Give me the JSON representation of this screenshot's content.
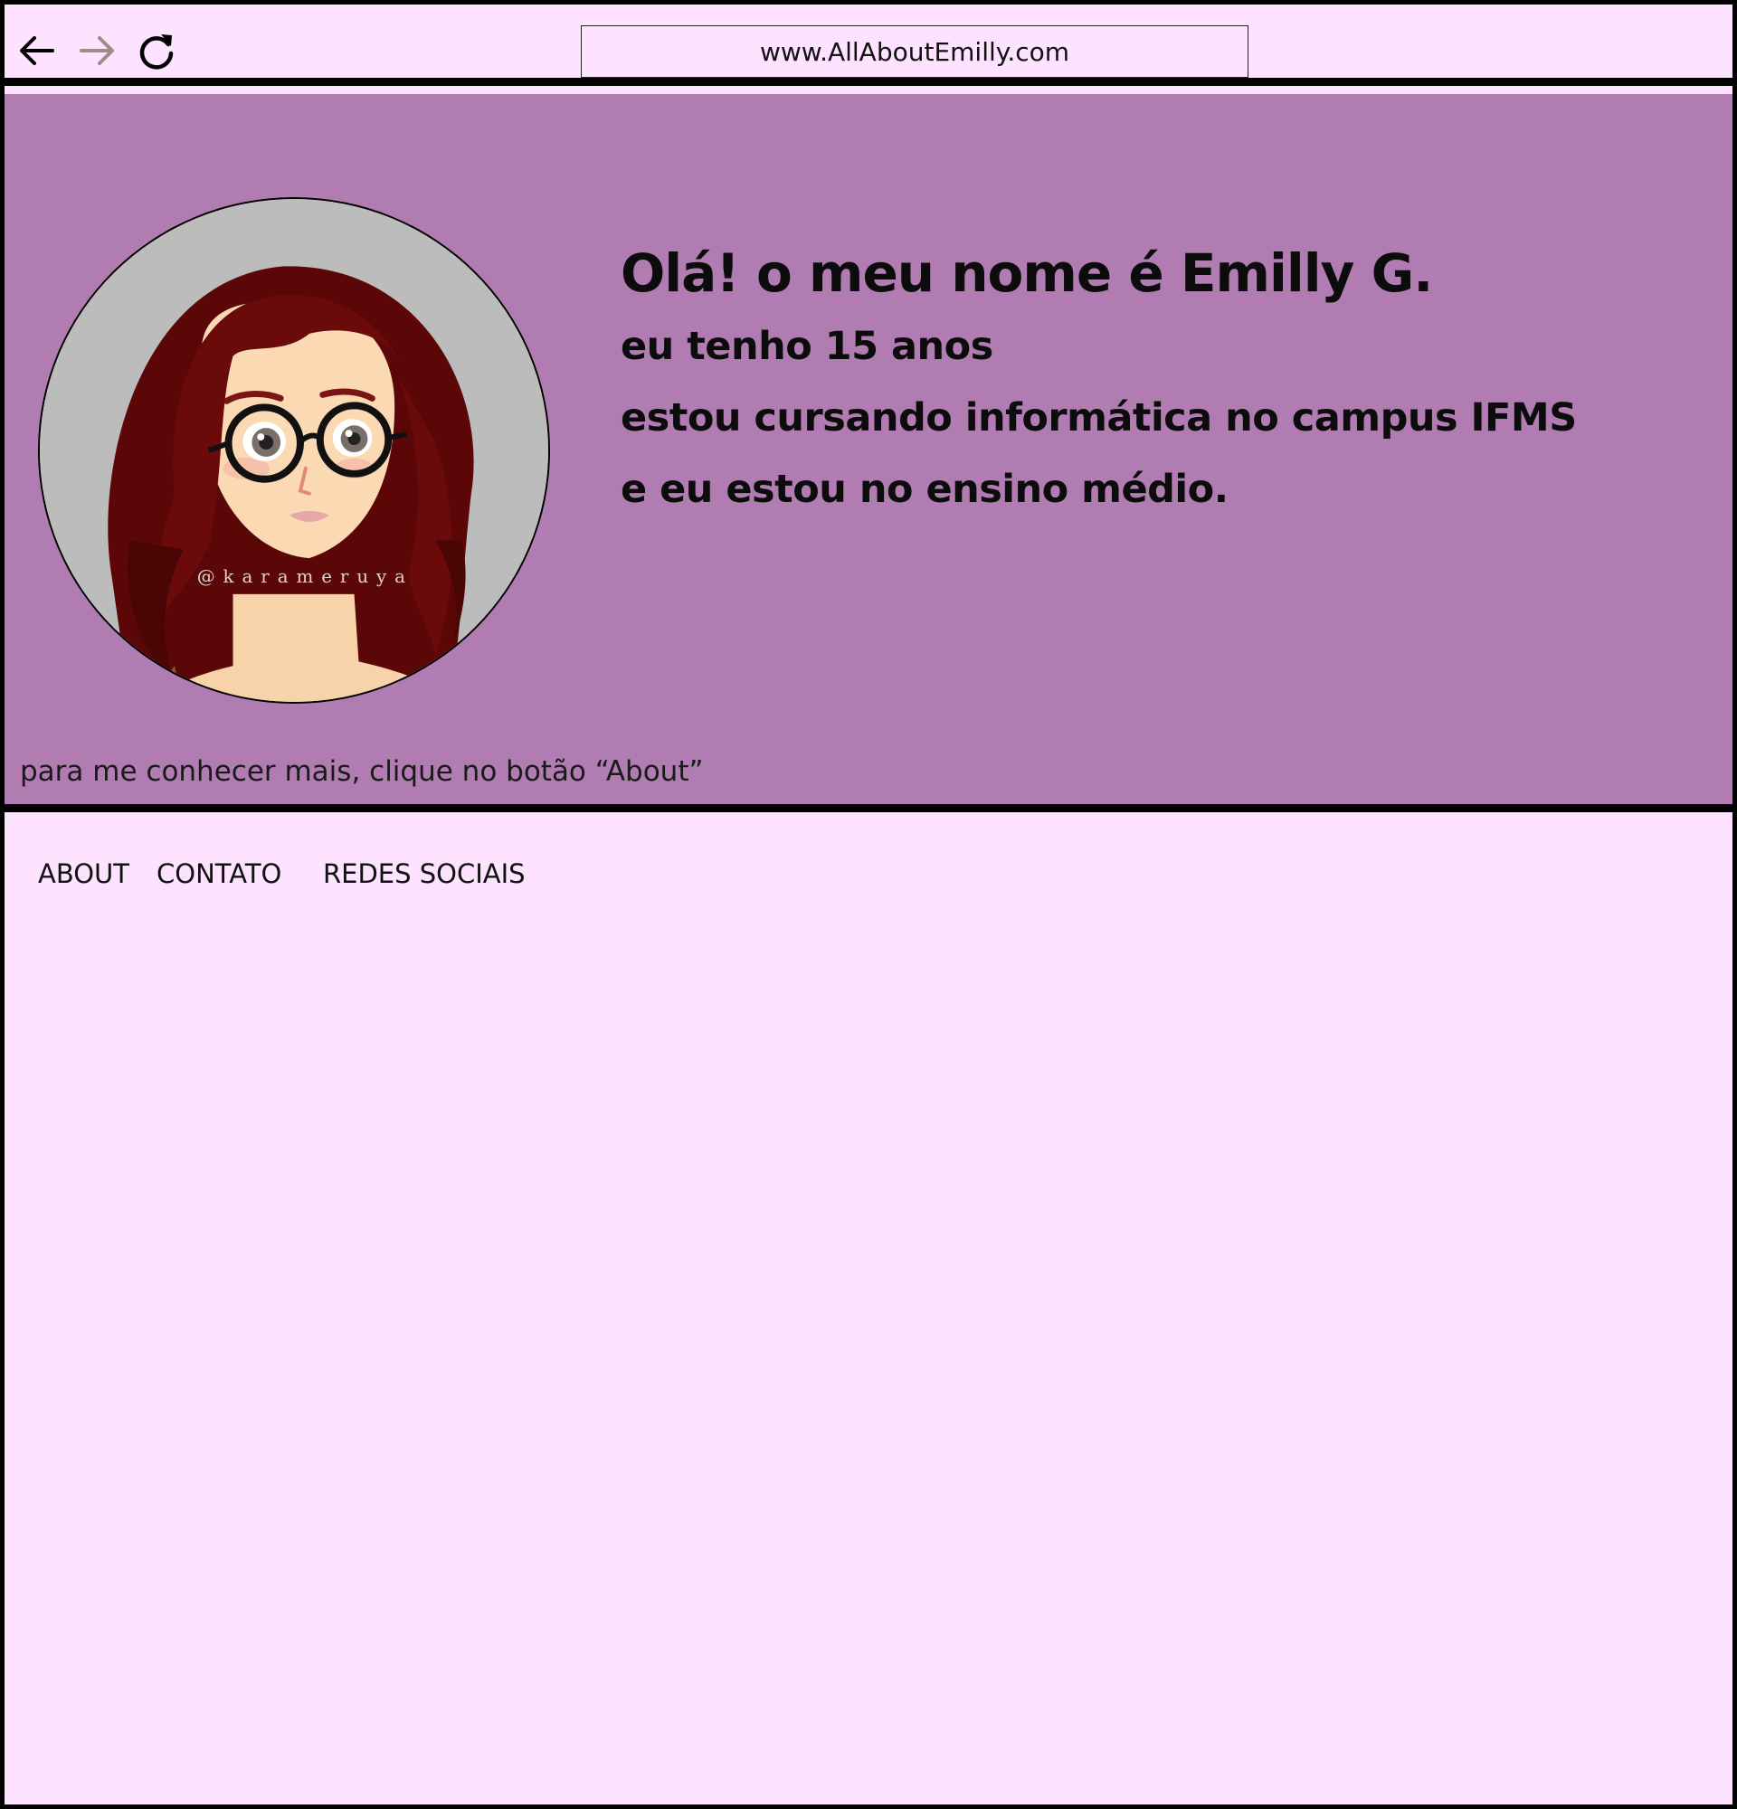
{
  "browser": {
    "url": "www.AllAboutEmilly.com",
    "back_icon": "arrow-left-icon",
    "forward_icon": "arrow-right-icon",
    "reload_icon": "reload-icon"
  },
  "hero": {
    "title": "Olá! o meu nome é Emilly G.",
    "lines": [
      "eu tenho 15 anos",
      "estou cursando informática no campus IFMS",
      "e eu estou no ensino médio."
    ],
    "hint": "para me conhecer mais, clique no botão “About”",
    "avatar_watermark": "@karameruya"
  },
  "nav": {
    "items": [
      {
        "label": "ABOUT"
      },
      {
        "label": "CONTATO"
      },
      {
        "label": "REDES SOCIAIS"
      }
    ]
  },
  "colors": {
    "page_background": "#fde3ff",
    "hero_background": "#b17cb2",
    "border": "#000000",
    "forward_arrow": "#a08a8a"
  }
}
